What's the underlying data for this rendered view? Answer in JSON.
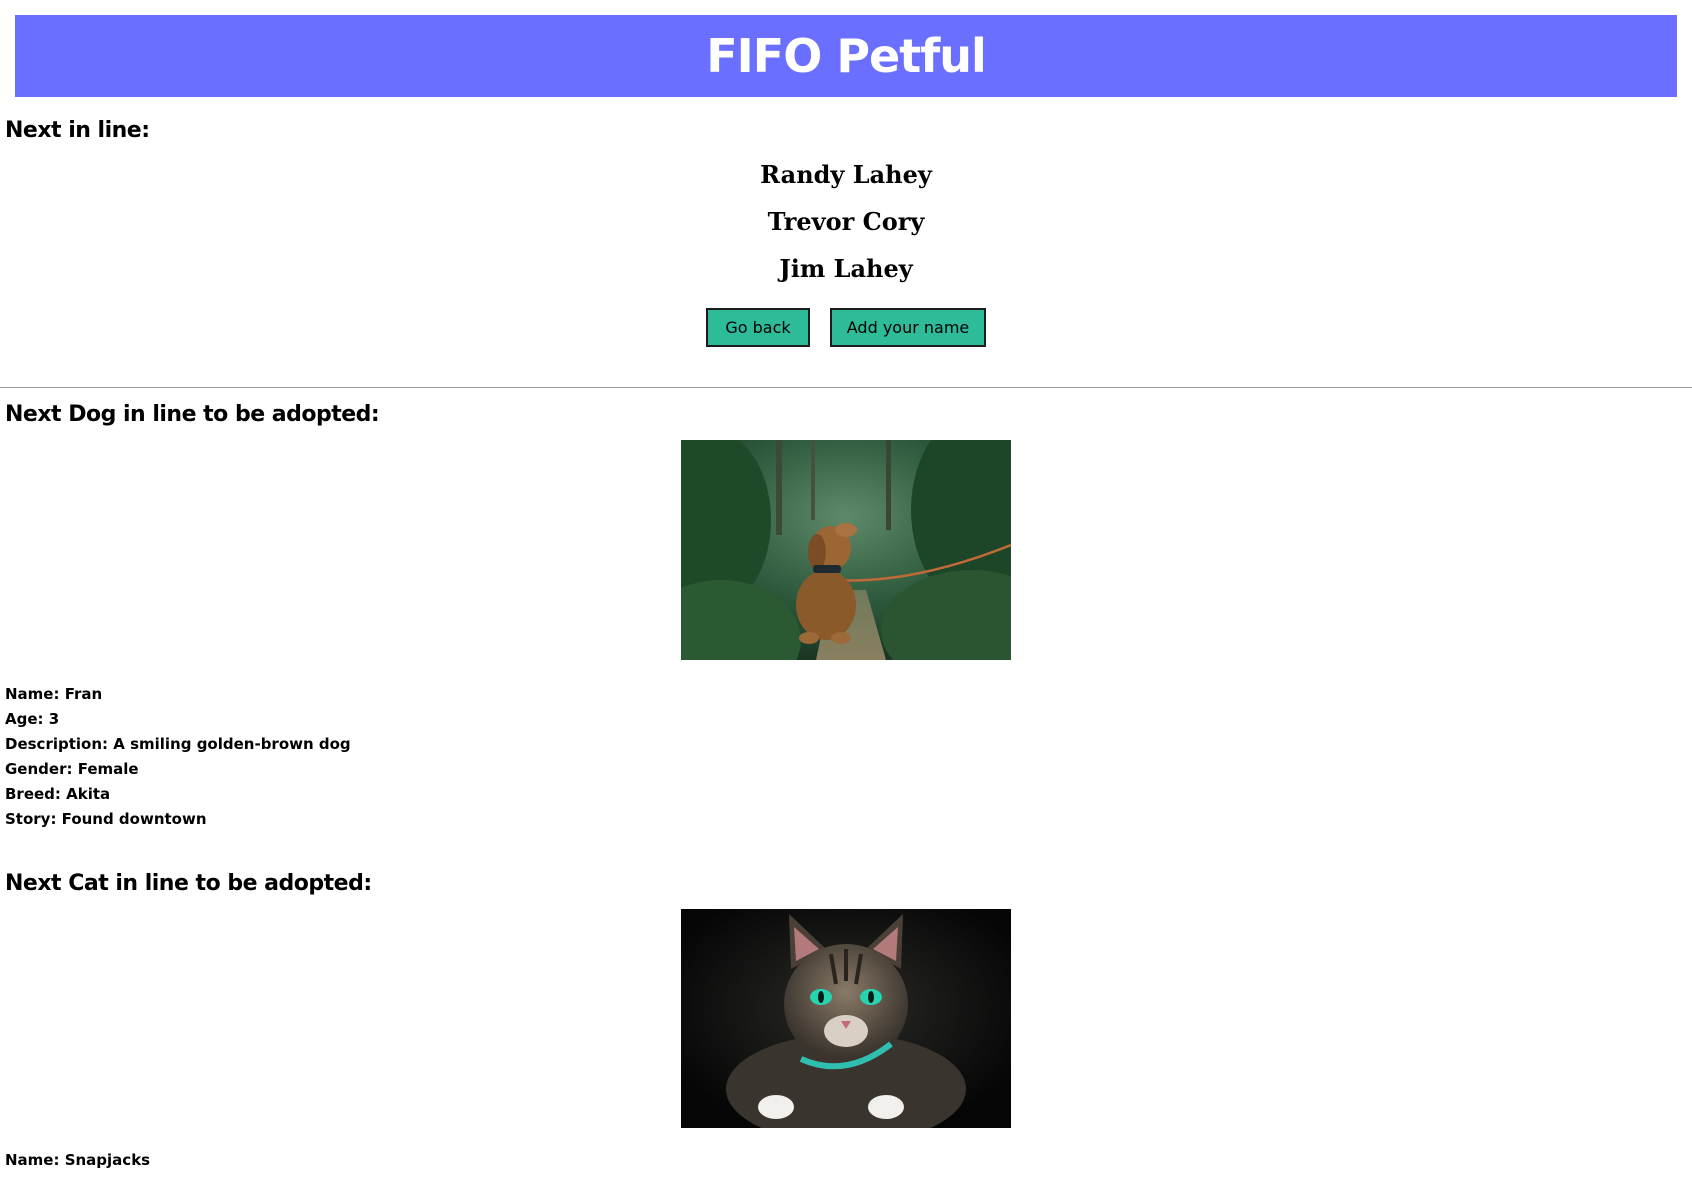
{
  "header": {
    "title": "FIFO Petful"
  },
  "queue": {
    "heading": "Next in line:",
    "people": [
      "Randy Lahey",
      "Trevor Cory",
      "Jim Lahey"
    ],
    "go_back_label": "Go back",
    "add_name_label": "Add your name"
  },
  "dog": {
    "heading": "Next Dog in line to be adopted:",
    "name": "Name: Fran",
    "age": "Age: 3",
    "description": "Description: A smiling golden-brown dog",
    "gender": "Gender: Female",
    "breed": "Breed: Akita",
    "story": "Story: Found downtown"
  },
  "cat": {
    "heading": "Next Cat in line to be adopted:",
    "name": "Name: Snapjacks"
  },
  "colors": {
    "banner": "#6b6fff",
    "button": "#2dbb98"
  }
}
